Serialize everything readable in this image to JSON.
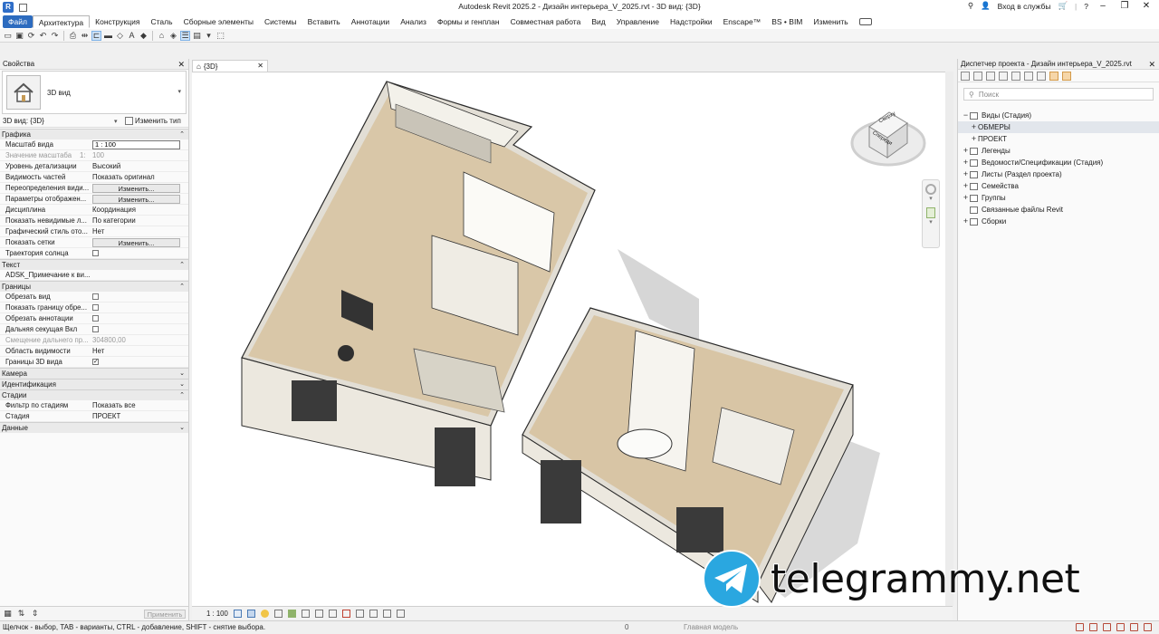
{
  "app": {
    "title": "Autodesk Revit 2025.2 - Дизайн интерьера_V_2025.rvt - 3D вид: {3D}",
    "logo_letter": "R",
    "sign_in": "Вход в службы",
    "help": "?",
    "win_min": "–",
    "win_max": "❐",
    "win_close": "✕"
  },
  "ribbon": {
    "tabs": [
      "Файл",
      "Архитектура",
      "Конструкция",
      "Сталь",
      "Сборные элементы",
      "Системы",
      "Вставить",
      "Аннотации",
      "Анализ",
      "Формы и генплан",
      "Совместная работа",
      "Вид",
      "Управление",
      "Надстройки",
      "Enscape™",
      "BS • BIM",
      "Изменить"
    ],
    "active_tab": "Архитектура"
  },
  "properties": {
    "header": "Свойства",
    "type_name": "3D вид",
    "instance_selector": "3D вид: {3D}",
    "edit_type": "Изменить тип",
    "apply": "Применить",
    "groups": {
      "graphics": "Графика",
      "text": "Текст",
      "extents": "Границы",
      "camera": "Камера",
      "identity": "Идентификация",
      "phasing": "Стадии",
      "data": "Данные"
    },
    "rows": {
      "scale_name": "Масштаб вида",
      "scale_val": "1 : 100",
      "scale_value_name": "Значение масштаба",
      "scale_value_prefix": "1:",
      "scale_value_val": "100",
      "detail_name": "Уровень детализации",
      "detail_val": "Высокий",
      "parts_name": "Видимость частей",
      "parts_val": "Показать оригинал",
      "overrides_name": "Переопределения види...",
      "display_name": "Параметры отображен...",
      "discipline_name": "Дисциплина",
      "discipline_val": "Координация",
      "hidden_name": "Показать невидимые л...",
      "hidden_val": "По категории",
      "graphic_style_name": "Графический стиль ото...",
      "graphic_style_val": "Нет",
      "grids_name": "Показать сетки",
      "sunpath_name": "Траектория солнца",
      "note_name": "ADSK_Примечание к ви...",
      "crop_name": "Обрезать вид",
      "crop_show_name": "Показать границу обре...",
      "crop_annot_name": "Обрезать аннотации",
      "far_clip_name": "Дальняя секущая Вкл",
      "far_offset_name": "Смещение дальнего пр...",
      "far_offset_val": "304800,00",
      "scope_name": "Область видимости",
      "scope_val": "Нет",
      "section_box_name": "Границы 3D вида",
      "phase_filter_name": "Фильтр по стадиям",
      "phase_filter_val": "Показать все",
      "phase_name": "Стадия",
      "phase_val": "ПРОЕКТ",
      "edit_btn": "Изменить..."
    }
  },
  "view": {
    "tab_label": "{3D}",
    "scale": "1 : 100",
    "viewcube_top": "Сверху",
    "viewcube_front": "Спереди",
    "colors": {
      "wall": "#eeebe3",
      "floor": "#dcc9ad",
      "shadow": "#cfcfcf"
    }
  },
  "browser": {
    "header": "Диспетчер проекта - Дизайн интерьера_V_2025.rvt",
    "search_placeholder": "Поиск",
    "tree": [
      {
        "toggle": "−",
        "label": "Виды (Стадия)",
        "level": 0,
        "selected": false
      },
      {
        "toggle": "+",
        "label": "ОБМЕРЫ",
        "level": 1,
        "selected": true
      },
      {
        "toggle": "+",
        "label": "ПРОЕКТ",
        "level": 1,
        "selected": false
      },
      {
        "toggle": "+",
        "label": "Легенды",
        "level": 0,
        "selected": false
      },
      {
        "toggle": "+",
        "label": "Ведомости/Спецификации (Стадия)",
        "level": 0,
        "selected": false
      },
      {
        "toggle": "+",
        "label": "Листы (Раздел проекта)",
        "level": 0,
        "selected": false
      },
      {
        "toggle": "+",
        "label": "Семейства",
        "level": 0,
        "selected": false
      },
      {
        "toggle": "+",
        "label": "Группы",
        "level": 0,
        "selected": false
      },
      {
        "toggle": "",
        "label": "Связанные файлы Revit",
        "level": 0,
        "selected": false
      },
      {
        "toggle": "+",
        "label": "Сборки",
        "level": 0,
        "selected": false
      }
    ]
  },
  "status": {
    "hint": "Щелчок - выбор, TAB - варианты, CTRL - добавление, SHIFT - снятие выбора.",
    "zero": "0",
    "model": "Главная модель"
  },
  "watermark": "telegrammy.net"
}
